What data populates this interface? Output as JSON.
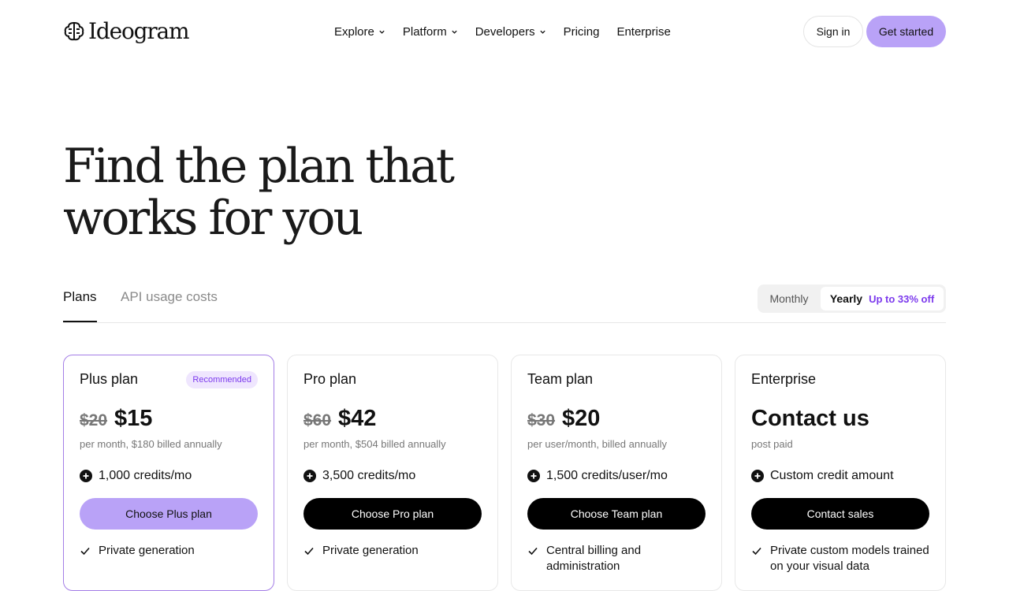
{
  "brand": {
    "name": "Ideogram"
  },
  "nav": {
    "items": [
      {
        "label": "Explore",
        "has_dropdown": true
      },
      {
        "label": "Platform",
        "has_dropdown": true
      },
      {
        "label": "Developers",
        "has_dropdown": true
      },
      {
        "label": "Pricing",
        "has_dropdown": false
      },
      {
        "label": "Enterprise",
        "has_dropdown": false
      }
    ],
    "sign_in": "Sign in",
    "get_started": "Get started"
  },
  "hero": {
    "title_line1": "Find the plan that",
    "title_line2": "works for you"
  },
  "tabs": {
    "plans": "Plans",
    "api": "API usage costs",
    "active": "plans"
  },
  "billing": {
    "monthly": "Monthly",
    "yearly": "Yearly",
    "discount": "Up to 33% off",
    "selected": "yearly"
  },
  "plans": [
    {
      "title": "Plus plan",
      "badge": "Recommended",
      "old_price": "$20",
      "price": "$15",
      "sub": "per month, $180 billed annually",
      "credits": "1,000 credits/mo",
      "cta": "Choose Plus plan",
      "feature": "Private generation"
    },
    {
      "title": "Pro plan",
      "old_price": "$60",
      "price": "$42",
      "sub": "per month, $504 billed annually",
      "credits": "3,500 credits/mo",
      "cta": "Choose Pro plan",
      "feature": "Private generation"
    },
    {
      "title": "Team plan",
      "old_price": "$30",
      "price": "$20",
      "sub": "per user/month, billed annually",
      "credits": "1,500 credits/user/mo",
      "cta": "Choose Team plan",
      "feature": "Central billing and administration"
    },
    {
      "title": "Enterprise",
      "price": "Contact us",
      "sub": "post paid",
      "credits": "Custom credit amount",
      "cta": "Contact sales",
      "feature": "Private custom models trained on your visual data"
    }
  ],
  "colors": {
    "accent_purple": "#b9a2f7",
    "discount_purple": "#7c3aed",
    "badge_bg": "#efe6fe",
    "featured_border": "#a47ee6"
  }
}
